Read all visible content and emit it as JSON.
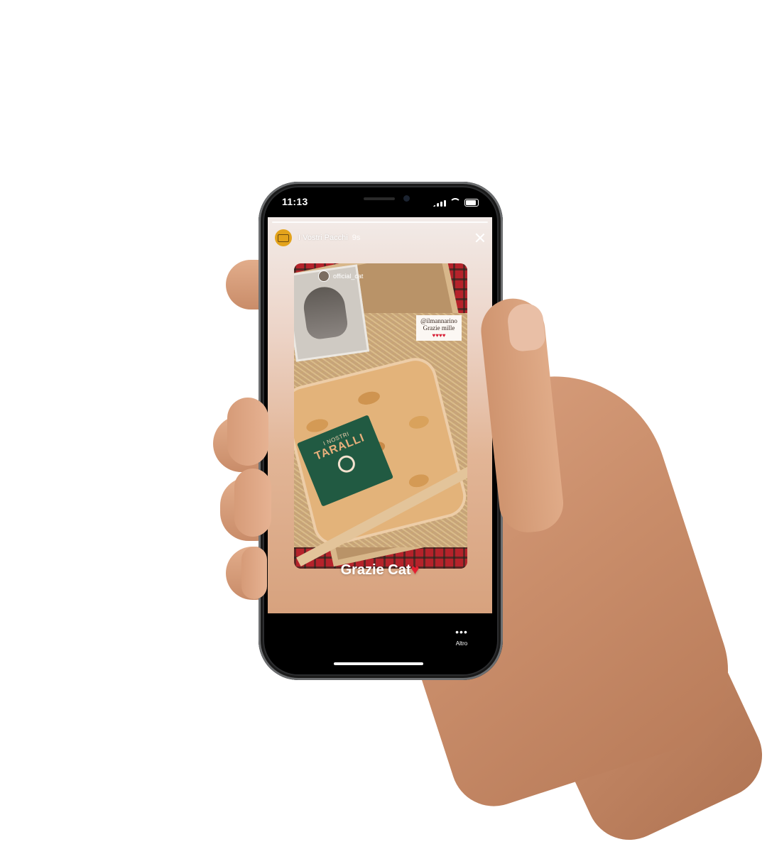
{
  "status_bar": {
    "time": "11:13"
  },
  "story": {
    "account_name": "I Vostri Pacchi",
    "time_ago": "9s",
    "photo": {
      "mention_user": "official_cat",
      "sticker_line1": "@ilmannarino",
      "sticker_line2": "Grazie mille",
      "sticker_hearts": "♥♥♥♥",
      "label_small": "I NOSTRI",
      "label_big": "TARALLI"
    },
    "caption_text": "Grazie Cat",
    "caption_heart": "♥"
  },
  "bottom_bar": {
    "more_label": "Altro"
  },
  "colors": {
    "story_top": "#f2ebe8",
    "story_bottom": "#d7a27e",
    "avatar_bg": "#e3a31c"
  },
  "icons": [
    "truck-icon",
    "close-icon",
    "more-icon",
    "signal-icon",
    "wifi-icon",
    "battery-icon"
  ]
}
